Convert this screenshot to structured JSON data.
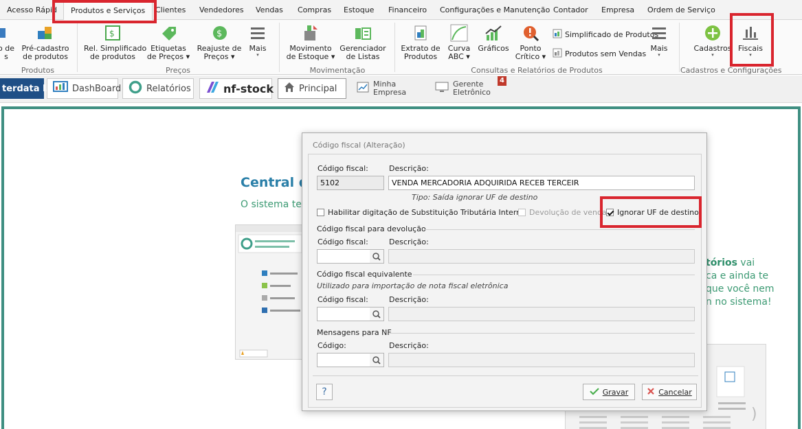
{
  "menu": {
    "tabs": [
      "Acesso Rápid",
      "Produtos e Serviços",
      "Clientes",
      "Vendedores",
      "Vendas",
      "Compras",
      "Estoque",
      "Financeiro",
      "Configurações e Manutenção",
      "Contador",
      "Empresa",
      "Ordem de Serviço"
    ]
  },
  "ribbon": {
    "groups": {
      "produtos": "Produtos",
      "precos": "Preços",
      "movimentacao": "Movimentação",
      "consultas": "Consultas e Relatórios de Produtos",
      "cadastros": "Cadastros e Configurações"
    },
    "buttons": {
      "partial_1": "o de",
      "partial_2": "s",
      "pre_cadastro_1": "Pré-cadastro",
      "pre_cadastro_2": "de produtos",
      "rel_simpl_1": "Rel. Simplificado",
      "rel_simpl_2": "de produtos",
      "etiquetas_1": "Etiquetas",
      "etiquetas_2": "de Preços",
      "reajuste_1": "Reajuste de",
      "reajuste_2": "Preços",
      "mais_1": "Mais",
      "movimento_1": "Movimento",
      "movimento_2": "de Estoque",
      "gerenciador_1": "Gerenciador",
      "gerenciador_2": "de Listas",
      "extrato_1": "Extrato de",
      "extrato_2": "Produtos",
      "curva_1": "Curva",
      "curva_2": "ABC",
      "graficos": "Gráficos",
      "ponto_1": "Ponto",
      "ponto_2": "Crítico",
      "simplificado": "Simplificado de Produtos",
      "sem_vendas": "Produtos sem Vendas",
      "mais_2": "Mais",
      "cadastros": "Cadastros",
      "fiscais": "Fiscais"
    }
  },
  "toolbar": {
    "interdata": "terdata IA",
    "dashboard": "DashBoard",
    "relatorios": "Relatórios",
    "nfstock": "nf-stock",
    "principal": "Principal",
    "minha_1": "Minha",
    "minha_2": "Empresa",
    "gerente_1": "Gerente",
    "gerente_2": "Eletrônico",
    "gerente_badge": "4"
  },
  "background": {
    "title": "Central de",
    "subtitle": "O sistema ter",
    "right_1": "tórios",
    "right_1b": " vai",
    "right_2": "ca e ainda te",
    "right_3": "que você nem",
    "right_4": "n no sistema!"
  },
  "dialog": {
    "title": "Código fiscal (Alteração)",
    "codigo_label": "Código fiscal:",
    "descricao_label": "Descrição:",
    "codigo_value": "5102",
    "descricao_value": "VENDA MERCADORIA ADQUIRIDA RECEB TERCEIR",
    "tipo": "Tipo: Saída ignorar UF de destino",
    "chk_substituicao": "Habilitar digitação de Substituição Tributária Interna",
    "chk_devolucao": "Devolução de venda",
    "chk_ignorar": "Ignorar UF de destino",
    "sec_devolucao": "Código fiscal para devolução",
    "dev_codigo_label": "Código fiscal:",
    "dev_descricao_label": "Descrição:",
    "sec_equivalente": "Código fiscal equivalente",
    "equiv_note": "Utilizado para importação de nota fiscal eletrônica",
    "eq_codigo_label": "Código fiscal:",
    "eq_descricao_label": "Descrição:",
    "sec_mensagens": "Mensagens para NF",
    "msg_codigo_label": "Código:",
    "msg_descricao_label": "Descrição:",
    "help": "?",
    "gravar": "Gravar",
    "cancelar": "Cancelar"
  },
  "colors": {
    "accent_green": "#3f8f82",
    "highlight_red": "#d9252e",
    "title_blue": "#2a7fa8"
  }
}
